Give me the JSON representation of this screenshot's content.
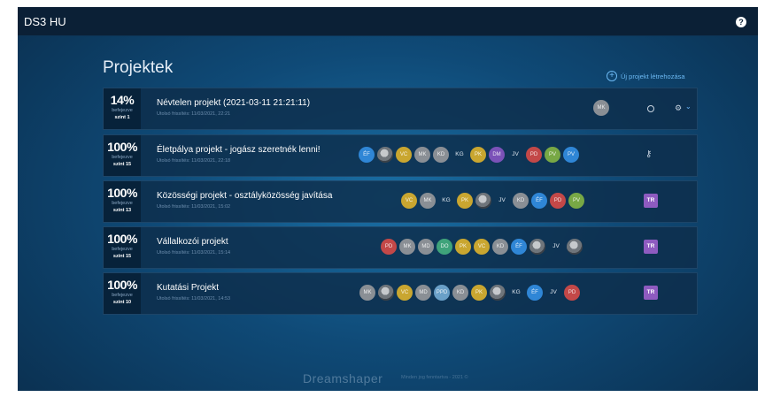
{
  "app": {
    "title": "DS3 HU",
    "help_icon": "help-icon"
  },
  "page": {
    "title": "Projektek",
    "new_project_label": "Új projekt létrehozása"
  },
  "projects": [
    {
      "percent": "14%",
      "status": "befejezve",
      "level": "szint 1",
      "title": "Névtelen projekt (2021-03-11 21:21:11)",
      "updated": "Utolsó frissítés: 11/03/2021, 22:21",
      "members": [
        {
          "initials": "MK",
          "color": "#8a8f95"
        }
      ]
    },
    {
      "percent": "100%",
      "status": "befejezve",
      "level": "szint 15",
      "title": "Életpálya projekt - jogász szeretnék lenni!",
      "updated": "Utolsó frissítés: 11/03/2021, 22:18",
      "members": [
        {
          "initials": "ÉF",
          "color": "#2f86d6"
        },
        {
          "initials": "",
          "color": "photo"
        },
        {
          "initials": "VC",
          "color": "#c9a630"
        },
        {
          "initials": "MK",
          "color": "#8a8f95"
        },
        {
          "initials": "KD",
          "color": "#8a8f95"
        },
        {
          "initials": "KG",
          "color": "text"
        },
        {
          "initials": "PK",
          "color": "#c9a630"
        },
        {
          "initials": "DM",
          "color": "#7b52b8"
        },
        {
          "initials": "JV",
          "color": "text"
        },
        {
          "initials": "PD",
          "color": "#c34848"
        },
        {
          "initials": "PV",
          "color": "#78a845"
        },
        {
          "initials": "PV",
          "color": "#2f86d6"
        }
      ]
    },
    {
      "percent": "100%",
      "status": "befejezve",
      "level": "szint 13",
      "title": "Közösségi projekt - osztályközösség javítása",
      "updated": "Utolsó frissítés: 11/03/2021, 15:02",
      "members": [
        {
          "initials": "VC",
          "color": "#c9a630"
        },
        {
          "initials": "MK",
          "color": "#8a8f95"
        },
        {
          "initials": "KG",
          "color": "text"
        },
        {
          "initials": "PK",
          "color": "#c9a630"
        },
        {
          "initials": "",
          "color": "photo"
        },
        {
          "initials": "JV",
          "color": "text"
        },
        {
          "initials": "KD",
          "color": "#8a8f95"
        },
        {
          "initials": "ÉF",
          "color": "#2f86d6"
        },
        {
          "initials": "PD",
          "color": "#c34848"
        },
        {
          "initials": "PV",
          "color": "#78a845"
        }
      ]
    },
    {
      "percent": "100%",
      "status": "befejezve",
      "level": "szint 15",
      "title": "Vállalkozói projekt",
      "updated": "Utolsó frissítés: 11/03/2021, 15:14",
      "members": [
        {
          "initials": "PD",
          "color": "#c34848"
        },
        {
          "initials": "MK",
          "color": "#8a8f95"
        },
        {
          "initials": "MD",
          "color": "#8a8f95"
        },
        {
          "initials": "DO",
          "color": "#3fa37a"
        },
        {
          "initials": "PK",
          "color": "#c9a630"
        },
        {
          "initials": "VC",
          "color": "#c9a630"
        },
        {
          "initials": "KD",
          "color": "#8a8f95"
        },
        {
          "initials": "ÉF",
          "color": "#2f86d6"
        },
        {
          "initials": "",
          "color": "photo"
        },
        {
          "initials": "JV",
          "color": "text"
        },
        {
          "initials": "",
          "color": "photo"
        }
      ]
    },
    {
      "percent": "100%",
      "status": "befejezve",
      "level": "szint 10",
      "title": "Kutatási Projekt",
      "updated": "Utolsó frissítés: 11/03/2021, 14:53",
      "members": [
        {
          "initials": "MK",
          "color": "#8a8f95"
        },
        {
          "initials": "",
          "color": "photo"
        },
        {
          "initials": "VC",
          "color": "#c9a630"
        },
        {
          "initials": "MD",
          "color": "#8a8f95"
        },
        {
          "initials": "PPD",
          "color": "#6aa0c8"
        },
        {
          "initials": "KD",
          "color": "#8a8f95"
        },
        {
          "initials": "PK",
          "color": "#c9a630"
        },
        {
          "initials": "",
          "color": "photo"
        },
        {
          "initials": "KG",
          "color": "text"
        },
        {
          "initials": "ÉF",
          "color": "#2f86d6"
        },
        {
          "initials": "JV",
          "color": "text"
        },
        {
          "initials": "PD",
          "color": "#c34848"
        }
      ]
    }
  ],
  "badges": {
    "owner": "TR"
  },
  "footer": {
    "logo": "Dreamshaper",
    "copyright": "Minden jog fenntartva - 2021 ©"
  }
}
